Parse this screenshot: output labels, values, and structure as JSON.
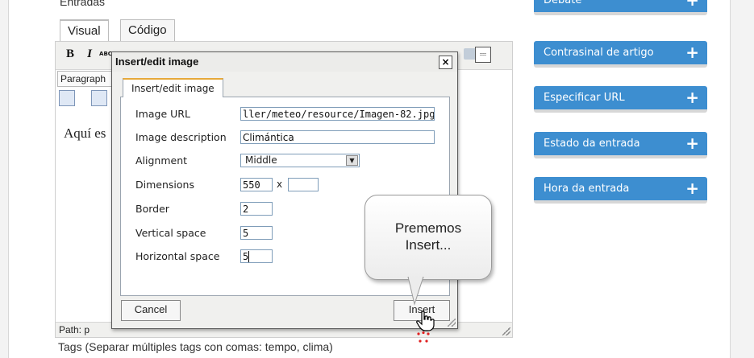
{
  "page": {
    "section_title": "Entradas",
    "tabs": [
      {
        "label": "Visual"
      },
      {
        "label": "Código"
      }
    ],
    "tags_label": "Tags (Separar múltiples tags con comas: tempo, clima)"
  },
  "editor": {
    "toolbar": {
      "bold": "B",
      "italic": "I",
      "strike": "ABC",
      "spellcheck": "ABC"
    },
    "format_select": "Paragraph",
    "content_text": "Aquí es",
    "path": "Path: p"
  },
  "dialog": {
    "title": "Insert/edit image",
    "close": "×",
    "tab": "Insert/edit image",
    "fields": {
      "image_url": {
        "label": "Image URL",
        "value": "ller/meteo/resource/Imagen-82.jpg"
      },
      "image_description": {
        "label": "Image description",
        "value": "Climántica"
      },
      "alignment": {
        "label": "Alignment",
        "value": "Middle"
      },
      "dimensions": {
        "label": "Dimensions",
        "width": "550",
        "separator": "x",
        "height": ""
      },
      "border": {
        "label": "Border",
        "value": "2"
      },
      "vertical_space": {
        "label": "Vertical space",
        "value": "5"
      },
      "horizontal_space": {
        "label": "Horizontal space",
        "value": "5"
      }
    },
    "cancel": "Cancel",
    "insert": "Insert"
  },
  "sidebar": {
    "items": [
      {
        "label": "Debate"
      },
      {
        "label": "Contrasinal de artigo"
      },
      {
        "label": "Especificar URL"
      },
      {
        "label": "Estado da entrada"
      },
      {
        "label": "Hora da entrada"
      }
    ],
    "accent_color": "#3d8ed0"
  },
  "callout": {
    "line1": "Prememos",
    "line2": "Insert..."
  }
}
